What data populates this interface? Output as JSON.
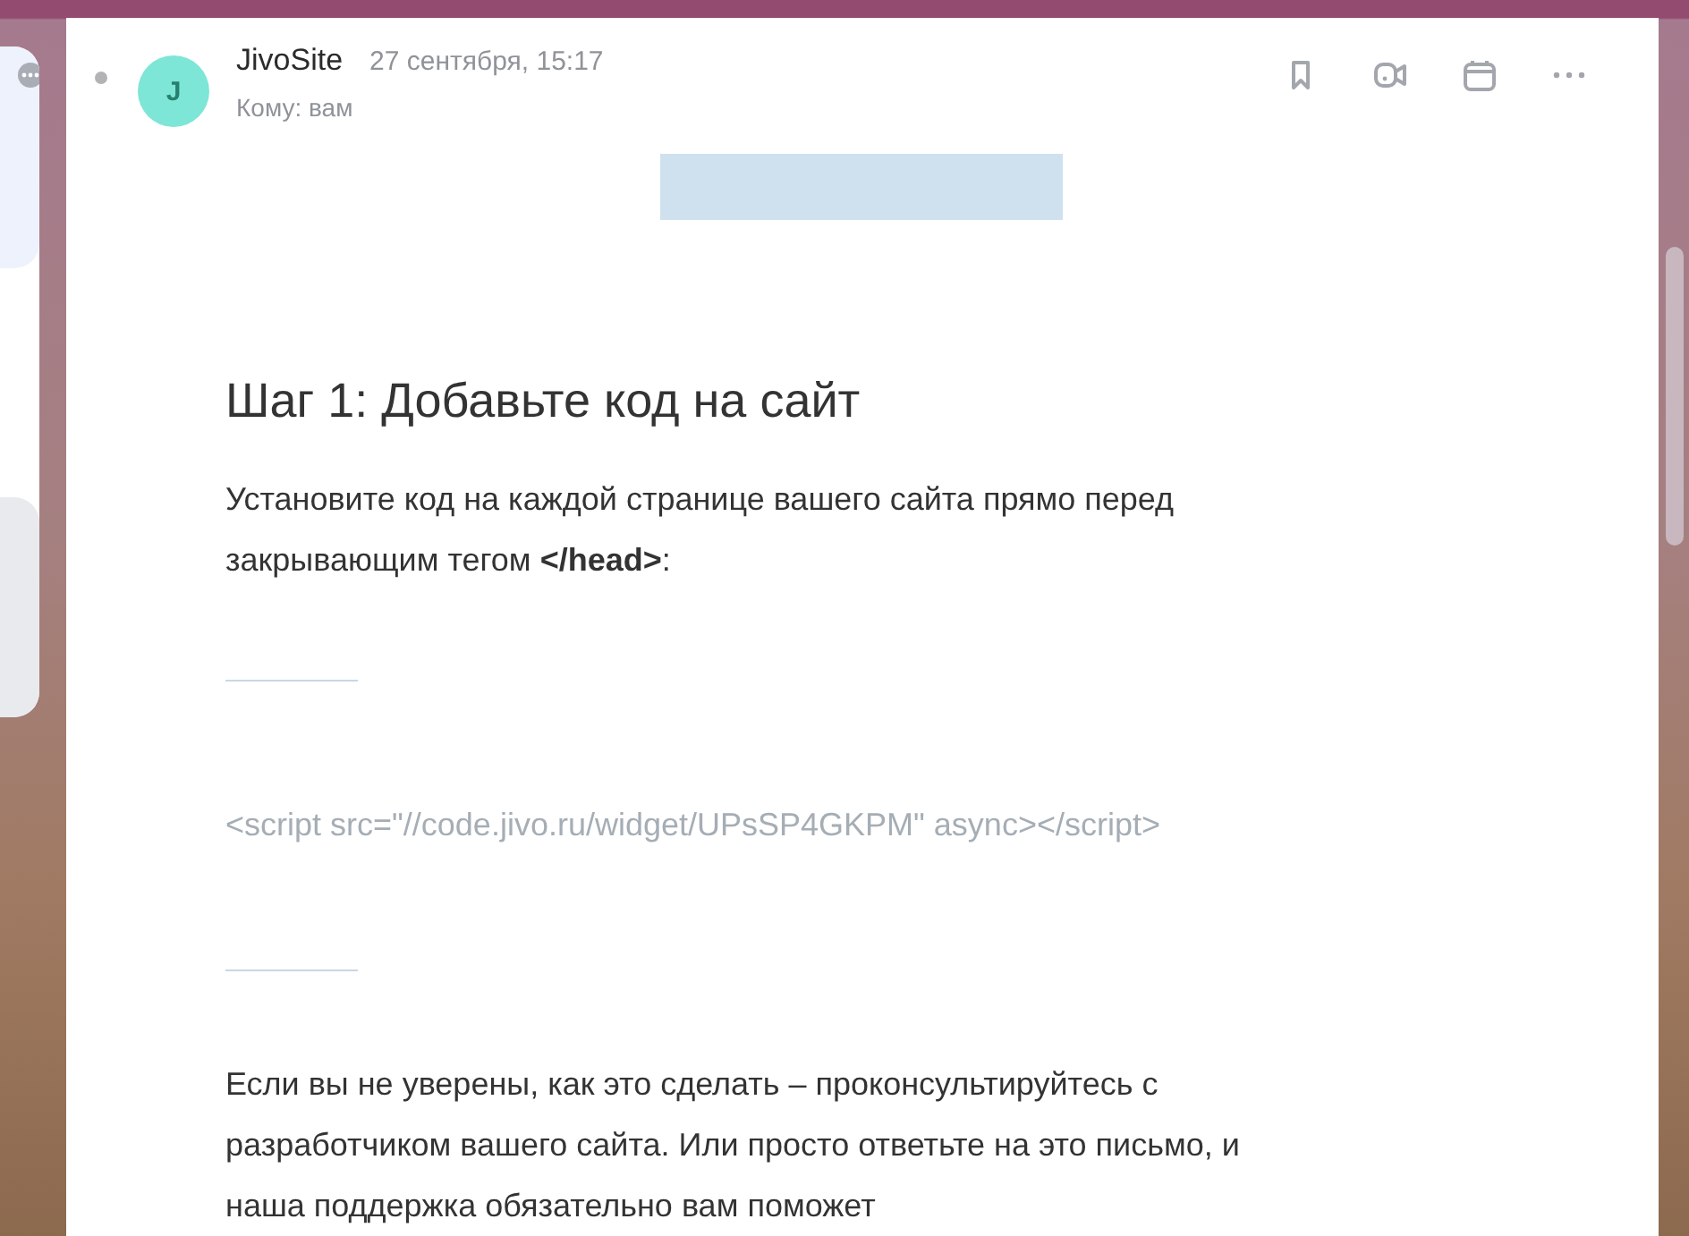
{
  "message": {
    "avatar": "J",
    "sender": "JivoSite",
    "date": "27 сентября, 15:17",
    "recipient": "Кому: вам",
    "actions": [
      {
        "kind": "bookmark"
      },
      {
        "kind": "video"
      },
      {
        "kind": "calendar"
      },
      {
        "kind": "more"
      }
    ]
  },
  "body": [
    {
      "kind": "image"
    },
    {
      "kind": "heading",
      "text": "Шаг 1: Добавьте код на сайт"
    },
    {
      "kind": "paragraph",
      "text": "Установите код на каждой странице вашего сайта прямо перед закрывающим тегом **</head>**:"
    },
    {
      "kind": "rule"
    },
    {
      "kind": "code",
      "text": "<script src=\"//code.jivo.ru/widget/UPsSP4GKPM\" async></script>"
    },
    {
      "kind": "rule"
    },
    {
      "kind": "paragraph",
      "text": "Если вы не уверены, как это сделать – проконсультируйтесь с разработчиком вашего сайта. Или просто ответьте на это письмо, и наша поддержка обязательно вам поможет"
    }
  ]
}
